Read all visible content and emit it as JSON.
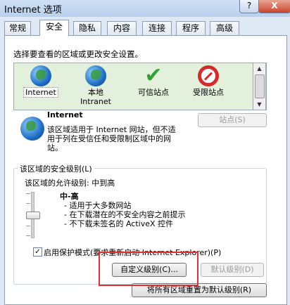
{
  "window": {
    "title": "Internet 选项",
    "help_label": "?",
    "close_label": "X"
  },
  "tabs": [
    {
      "label": "常规"
    },
    {
      "label": "安全",
      "active": true
    },
    {
      "label": "隐私"
    },
    {
      "label": "内容"
    },
    {
      "label": "连接"
    },
    {
      "label": "程序"
    },
    {
      "label": "高级"
    }
  ],
  "security": {
    "zone_prompt": "选择要查看的区域或更改安全设置。",
    "zones": [
      {
        "label": "Internet",
        "icon": "globe-icon",
        "selected": true
      },
      {
        "label": "本地\nIntranet",
        "icon": "intranet-icon"
      },
      {
        "label": "可信站点",
        "icon": "checkmark-icon"
      },
      {
        "label": "受限站点",
        "icon": "no-entry-icon"
      }
    ],
    "selected_zone": {
      "name": "Internet",
      "description": "该区域适用于 Internet 网站，但不适用于列在受信任和受限制区域中的网站。",
      "sites_button": "站点(S)"
    },
    "level_group": {
      "legend": "该区域的安全级别(L)",
      "allowed": "该区域的允许级别: 中到高",
      "level_name": "中-高",
      "level_fraction": 0.5,
      "bullets": [
        "适用于大多数网站",
        "在下载潜在的不安全内容之前提示",
        "不下载未签名的 ActiveX 控件"
      ],
      "protected_mode_label": "启用保护模式(要求重新启动 Internet Explorer)(P)",
      "protected_mode_checked": true,
      "custom_button": "自定义级别(C)...",
      "default_button": "默认级别(D)"
    },
    "reset_button": "将所有区域重置为默认级别(R)"
  },
  "colors": {
    "zone_bg": "#e3f0dc",
    "highlight": "#e03030",
    "window_bg": "#dfe9f5"
  }
}
